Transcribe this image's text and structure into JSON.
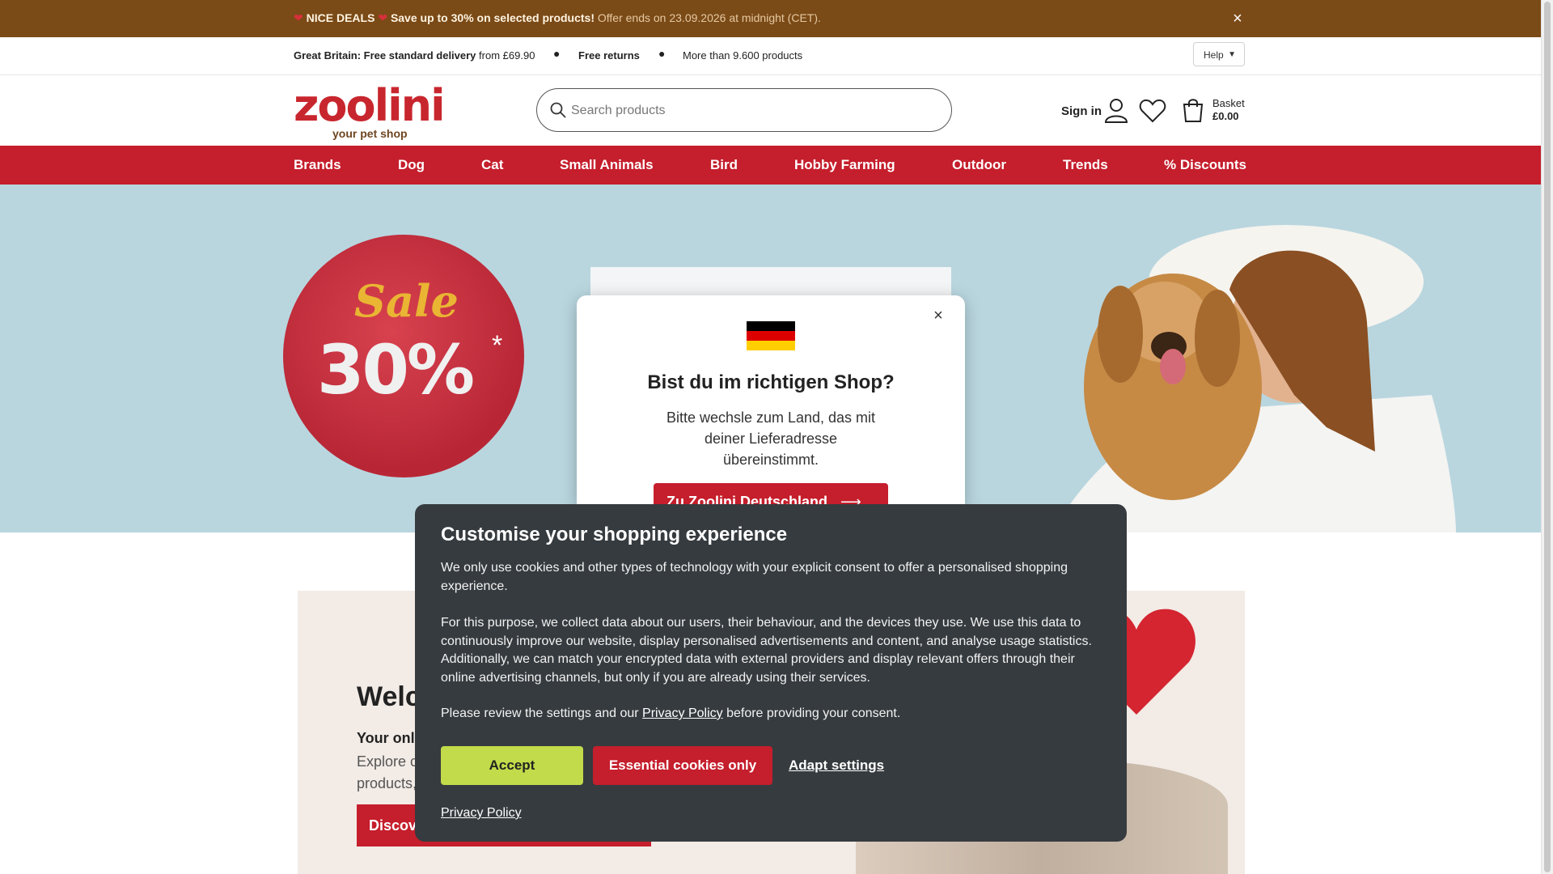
{
  "promo": {
    "deal_label": "NICE DEALS",
    "deal_text": "Save up to 30% on selected products!",
    "offer_note": "Offer ends on 23.09.2026 at midnight (CET).",
    "close_icon": "close-icon"
  },
  "usp": {
    "delivery_bold": "Great Britain: Free standard delivery",
    "delivery_rest": "from £69.90",
    "returns": "Free returns",
    "products": "More than 9.600 products",
    "help": "Help"
  },
  "header": {
    "logo_word": "zoolini",
    "logo_tagline": "your pet shop",
    "search_placeholder": "Search products",
    "sign_in": "Sign in",
    "basket_label": "Basket",
    "basket_amount": "£0.00"
  },
  "nav": {
    "items": [
      "Brands",
      "Dog",
      "Cat",
      "Small Animals",
      "Bird",
      "Hobby Farming",
      "Outdoor",
      "Trends",
      "% Discounts"
    ]
  },
  "hero": {
    "sale_word": "Sale",
    "sale_percent": "30%",
    "sale_star": "*"
  },
  "lower": {
    "welcome": "Welc",
    "subtitle": "Your onl",
    "text_line1": "Explore c",
    "text_line2": "products,",
    "button": "Discov"
  },
  "country_modal": {
    "title": "Bist du im richtigen Shop?",
    "body": "Bitte wechsle zum Land, das mit deiner Lieferadresse übereinstimmt.",
    "button": "Zu Zoolini Deutschland",
    "flag_colors": [
      "#000000",
      "#dd0000",
      "#ffce00"
    ]
  },
  "cookie_modal": {
    "title": "Customise your shopping experience",
    "p1": "We only use cookies and other types of technology with your explicit consent to offer a personalised shopping experience.",
    "p2": "For this purpose, we collect data about our users, their behaviour, and the devices they use. We use this data to continuously improve our website, display personalised advertisements and content, and analyse usage statistics. Additionally, we can match your encrypted data with external providers and display relevant offers through their online advertising channels, but only if you are already using their services.",
    "p3_before": "Please review the settings and our",
    "p3_link": "Privacy Policy",
    "p3_after": "before providing your consent.",
    "accept": "Accept",
    "essential": "Essential cookies only",
    "adapt": "Adapt settings",
    "privacy_link": "Privacy Policy"
  },
  "colors": {
    "brand_red": "#c51e2c",
    "promo_brown": "#7a4a17",
    "accept_green": "#c2db4a",
    "modal_dark": "#363b3f"
  }
}
